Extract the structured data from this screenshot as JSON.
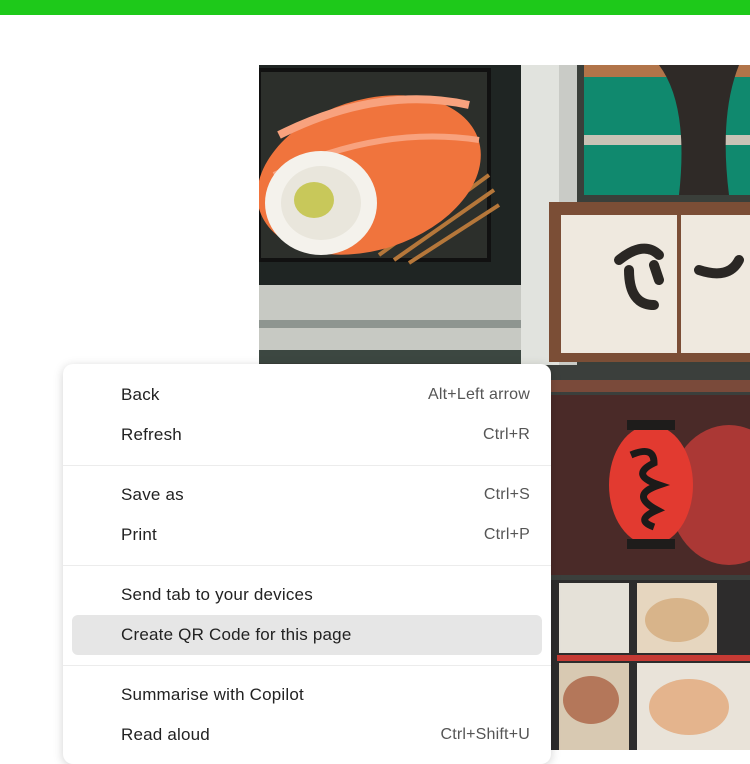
{
  "context_menu": {
    "groups": [
      {
        "items": [
          {
            "label": "Back",
            "shortcut": "Alt+Left arrow"
          },
          {
            "label": "Refresh",
            "shortcut": "Ctrl+R"
          }
        ]
      },
      {
        "items": [
          {
            "label": "Save as",
            "shortcut": "Ctrl+S"
          },
          {
            "label": "Print",
            "shortcut": "Ctrl+P"
          }
        ]
      },
      {
        "items": [
          {
            "label": "Send tab to your devices",
            "shortcut": ""
          },
          {
            "label": "Create QR Code for this page",
            "shortcut": "",
            "highlighted": true
          }
        ]
      },
      {
        "items": [
          {
            "label": "Summarise with Copilot",
            "shortcut": ""
          },
          {
            "label": "Read aloud",
            "shortcut": "Ctrl+Shift+U"
          }
        ]
      }
    ]
  },
  "photo": {
    "subject": "sushi-and-lantern-street-photo"
  },
  "colors": {
    "accent_bar": "#1ec91a",
    "menu_hover": "#e6e6e6"
  }
}
